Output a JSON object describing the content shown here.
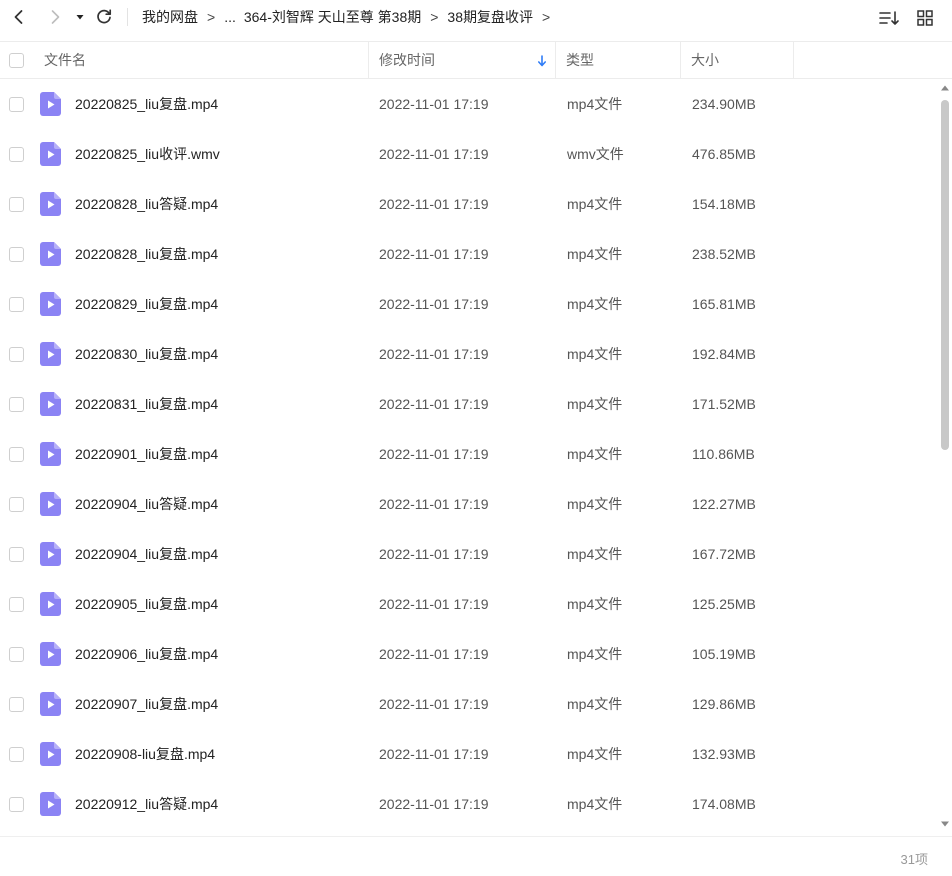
{
  "toolbar": {
    "icons": {
      "back": "chevron-left-icon",
      "forward": "chevron-right-icon",
      "history": "caret-down-icon",
      "refresh": "refresh-icon",
      "sort": "sort-list-icon",
      "view": "grid-view-icon"
    }
  },
  "breadcrumb": {
    "root": "我的网盘",
    "ellipsis": "...",
    "level1": "364-刘智辉 天山至尊 第38期",
    "current": "38期复盘收评",
    "separator": ">"
  },
  "columns": {
    "name": "文件名",
    "modified": "修改时间",
    "type": "类型",
    "size": "大小"
  },
  "colors": {
    "video_icon": "#8b83f4",
    "text": "#333333",
    "muted": "#999999",
    "sort_arrow": "#2f7cf6"
  },
  "files": [
    {
      "name": "20220825_liu复盘.mp4",
      "modified": "2022-11-01 17:19",
      "type": "mp4文件",
      "size": "234.90MB"
    },
    {
      "name": "20220825_liu收评.wmv",
      "modified": "2022-11-01 17:19",
      "type": "wmv文件",
      "size": "476.85MB"
    },
    {
      "name": "20220828_liu答疑.mp4",
      "modified": "2022-11-01 17:19",
      "type": "mp4文件",
      "size": "154.18MB"
    },
    {
      "name": "20220828_liu复盘.mp4",
      "modified": "2022-11-01 17:19",
      "type": "mp4文件",
      "size": "238.52MB"
    },
    {
      "name": "20220829_liu复盘.mp4",
      "modified": "2022-11-01 17:19",
      "type": "mp4文件",
      "size": "165.81MB"
    },
    {
      "name": "20220830_liu复盘.mp4",
      "modified": "2022-11-01 17:19",
      "type": "mp4文件",
      "size": "192.84MB"
    },
    {
      "name": "20220831_liu复盘.mp4",
      "modified": "2022-11-01 17:19",
      "type": "mp4文件",
      "size": "171.52MB"
    },
    {
      "name": "20220901_liu复盘.mp4",
      "modified": "2022-11-01 17:19",
      "type": "mp4文件",
      "size": "110.86MB"
    },
    {
      "name": "20220904_liu答疑.mp4",
      "modified": "2022-11-01 17:19",
      "type": "mp4文件",
      "size": "122.27MB"
    },
    {
      "name": "20220904_liu复盘.mp4",
      "modified": "2022-11-01 17:19",
      "type": "mp4文件",
      "size": "167.72MB"
    },
    {
      "name": "20220905_liu复盘.mp4",
      "modified": "2022-11-01 17:19",
      "type": "mp4文件",
      "size": "125.25MB"
    },
    {
      "name": "20220906_liu复盘.mp4",
      "modified": "2022-11-01 17:19",
      "type": "mp4文件",
      "size": "105.19MB"
    },
    {
      "name": "20220907_liu复盘.mp4",
      "modified": "2022-11-01 17:19",
      "type": "mp4文件",
      "size": "129.86MB"
    },
    {
      "name": "20220908-liu复盘.mp4",
      "modified": "2022-11-01 17:19",
      "type": "mp4文件",
      "size": "132.93MB"
    },
    {
      "name": "20220912_liu答疑.mp4",
      "modified": "2022-11-01 17:19",
      "type": "mp4文件",
      "size": "174.08MB"
    }
  ],
  "footer": {
    "count": "31项"
  }
}
